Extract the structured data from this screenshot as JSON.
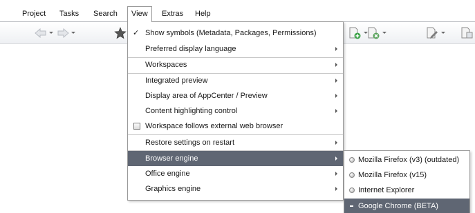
{
  "menubar": {
    "items": [
      {
        "label": "Project"
      },
      {
        "label": "Tasks"
      },
      {
        "label": "Search"
      },
      {
        "label": "View"
      },
      {
        "label": "Extras"
      },
      {
        "label": "Help"
      }
    ],
    "active": "View"
  },
  "toolbar": {
    "buttons": [
      {
        "icon": "back-arrow-icon",
        "enabled": false
      },
      {
        "icon": "forward-arrow-icon",
        "enabled": false
      },
      {
        "icon": "star-icon",
        "enabled": true
      },
      {
        "icon": "document-add-icon",
        "enabled": true
      },
      {
        "icon": "document-remove-icon",
        "enabled": true
      },
      {
        "icon": "document-edit-icon",
        "enabled": true
      },
      {
        "icon": "document-share-icon",
        "enabled": true
      }
    ]
  },
  "view_menu": {
    "items": [
      {
        "label": "Show symbols (Metadata, Packages, Permissions)",
        "checked": true,
        "submenu": false
      },
      {
        "label": "Preferred display language",
        "submenu": true
      },
      {
        "label": "Workspaces",
        "submenu": true
      },
      {
        "label": "Integrated preview",
        "submenu": true
      },
      {
        "label": "Display area of AppCenter / Preview",
        "submenu": true
      },
      {
        "label": "Content highlighting control",
        "submenu": true
      },
      {
        "label": "Workspace follows external web browser",
        "checkbox": true,
        "checked": false
      },
      {
        "label": "Restore settings on restart",
        "submenu": true
      },
      {
        "label": "Browser engine",
        "submenu": true,
        "highlighted": true
      },
      {
        "label": "Office engine",
        "submenu": true
      },
      {
        "label": "Graphics engine",
        "submenu": true
      }
    ]
  },
  "browser_engine_submenu": {
    "items": [
      {
        "label": "Mozilla Firefox (v3) (outdated)",
        "selected": false
      },
      {
        "label": "Mozilla Firefox (v15)",
        "selected": false
      },
      {
        "label": "Internet Explorer",
        "selected": false
      },
      {
        "label": "Google Chrome (BETA)",
        "selected": true
      }
    ]
  },
  "colors": {
    "highlight": "#5f6673",
    "menu_border": "#9a9a9a"
  }
}
